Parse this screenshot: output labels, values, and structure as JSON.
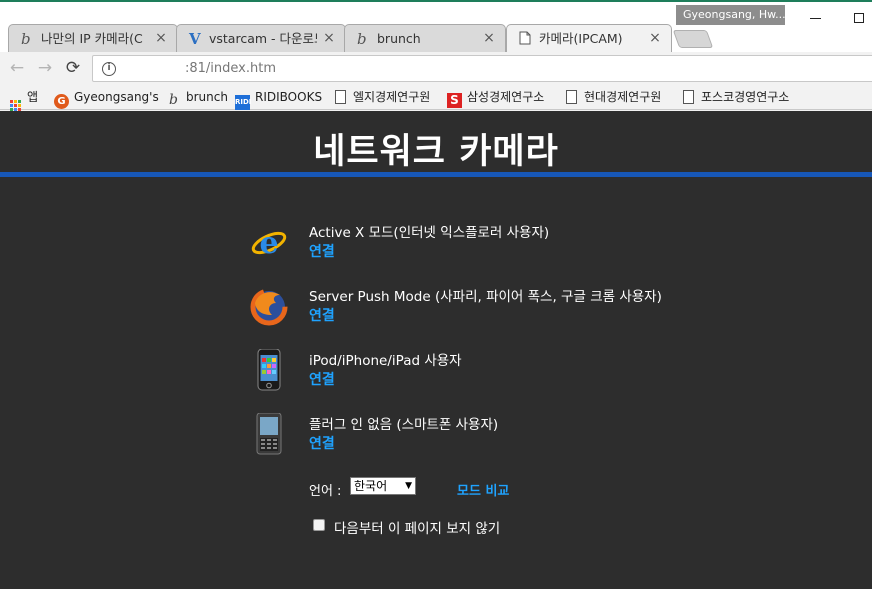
{
  "window": {
    "profile_name": "Gyeongsang, Hw..."
  },
  "tabs": [
    {
      "label": "나만의 IP 카메라(C",
      "close": "×"
    },
    {
      "label": "vstarcam - 다운로드",
      "close": "×"
    },
    {
      "label": "brunch",
      "close": "×"
    },
    {
      "label": "카메라(IPCAM)",
      "close": "×"
    }
  ],
  "toolbar": {
    "back": "←",
    "forward": "→",
    "reload": "⟳",
    "info": "i",
    "url": ":81/index.htm"
  },
  "bookmarks": [
    {
      "label": "앱"
    },
    {
      "label": "Gyeongsang's",
      "icon_text": "G"
    },
    {
      "label": "brunch",
      "icon_text": "b"
    },
    {
      "label": "RIDIBOOKS",
      "icon_text": "RIDI"
    },
    {
      "label": "엘지경제연구원"
    },
    {
      "label": "삼성경제연구소",
      "icon_text": "S"
    },
    {
      "label": "현대경제연구원"
    },
    {
      "label": "포스코경영연구소"
    }
  ],
  "page": {
    "title": "네트워크 카메라",
    "accent_color": "#1757b7",
    "link_color": "#1fa3ff",
    "modes": [
      {
        "title": "Active X 모드(인터넷 익스플로러 사용자)",
        "link": "연결",
        "icon": "internet-explorer-icon"
      },
      {
        "title": "Server Push Mode (사파리, 파이어 폭스, 구글 크롬 사용자)",
        "link": "연결",
        "icon": "firefox-icon"
      },
      {
        "title": "iPod/iPhone/iPad 사용자",
        "link": "연결",
        "icon": "iphone-icon"
      },
      {
        "title": "플러그 인 없음 (스마트폰 사용자)",
        "link": "연결",
        "icon": "smartphone-icon"
      }
    ],
    "language": {
      "label": "언어 :",
      "selected": "한국어"
    },
    "mode_compare": "모드 비교",
    "dont_show": "다음부터 이 페이지 보지 않기"
  }
}
